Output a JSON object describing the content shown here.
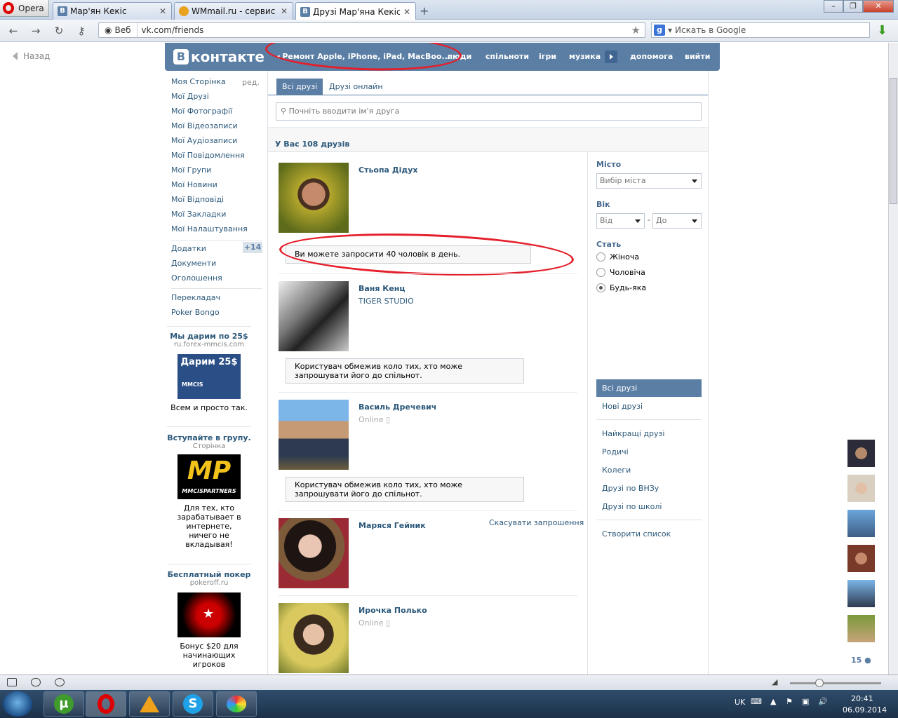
{
  "browser": {
    "menu_label": "Opera",
    "tabs": [
      {
        "label": "Мар'ян Кекіс",
        "icon": "В"
      },
      {
        "label": "WMmail.ru - сервис п...",
        "icon": "wm"
      },
      {
        "label": "Друзі Мар'яна Кекіса |...",
        "icon": "В"
      }
    ],
    "site_label": "Веб",
    "url": "vk.com/friends",
    "search_placeholder": "Искать в Google"
  },
  "back_label": "Назад",
  "header": {
    "logo": "контакте",
    "logo_letter": "В",
    "ad_link": "Ремонт Apple, iPhone, iPad, MacBoo...",
    "nav": [
      "люди",
      "спільноти",
      "ігри",
      "музика",
      "допомога",
      "вийти"
    ]
  },
  "left_menu": {
    "items": [
      "Моя Сторінка",
      "Мої Друзі",
      "Мої Фотографії",
      "Мої Відеозаписи",
      "Мої Аудіозаписи",
      "Мої Повідомлення",
      "Мої Групи",
      "Мої Новини",
      "Мої Відповіді",
      "Мої Закладки",
      "Мої Налаштування"
    ],
    "edit": "ред.",
    "items2": [
      "Додатки",
      "Документи",
      "Оголошення"
    ],
    "apps_badge": "+14",
    "items3": [
      "Перекладач",
      "Poker Bongo"
    ]
  },
  "ads": [
    {
      "title": "Мы дарим по 25$",
      "url": "ru.forex-mmcis.com",
      "img_text": "Дарим 25$",
      "img_sub": "MMCIS",
      "desc": "Всем и просто так."
    },
    {
      "title": "Вступайте в групу.",
      "url": "Сторінка",
      "img_text": "MP",
      "img_sub": "MMCISPARTNERS",
      "desc": "Для тех, кто зарабатывает в интернете, ничего не вкладывая!"
    },
    {
      "title": "Бесплатный покер",
      "url": "pokeroff.ru",
      "desc": "Бонус $20 для начинающих игроков"
    }
  ],
  "tabs": {
    "all": "Всі друзі",
    "online": "Друзі онлайн"
  },
  "search_placeholder": "Почніть вводити ім'я друга",
  "friends_count": "У Вас 108 друзів",
  "friends": [
    {
      "name": "Стьопа Дідух",
      "note": "Ви можете запросити 40 чоловік в день."
    },
    {
      "name": "Ваня Кенц",
      "sub": "TIGER STUDIO",
      "note": "Користувач обмежив коло тих, хто може запрошувати його до спільнот."
    },
    {
      "name": "Василь Дречевич",
      "online": "Online",
      "note": "Користувач обмежив коло тих, хто може запрошувати його до спільнот."
    },
    {
      "name": "Маряся Гейник",
      "action": "Скасувати запрошення"
    },
    {
      "name": "Ирочка Полько",
      "online": "Online"
    }
  ],
  "filters": {
    "city_label": "Місто",
    "city_value": "Вибір міста",
    "age_label": "Вік",
    "age_from": "Від",
    "age_dash": "-",
    "age_to": "До",
    "gender_label": "Стать",
    "genders": [
      "Жіноча",
      "Чоловіча",
      "Будь-яка"
    ],
    "gender_selected": 2
  },
  "sections": {
    "active": "Всі друзі",
    "new": "Нові друзі",
    "list": [
      "Найкращі друзі",
      "Родичі",
      "Колеги",
      "Друзі по ВНЗу",
      "Друзі по школі"
    ],
    "create": "Створити список"
  },
  "online_count": "15",
  "taskbar": {
    "lang": "UK",
    "time": "20:41",
    "date": "06.09.2014"
  },
  "colors": {
    "vk_blue": "#5b7ea5",
    "link": "#2b587a",
    "annotation": "#e51e2a"
  }
}
